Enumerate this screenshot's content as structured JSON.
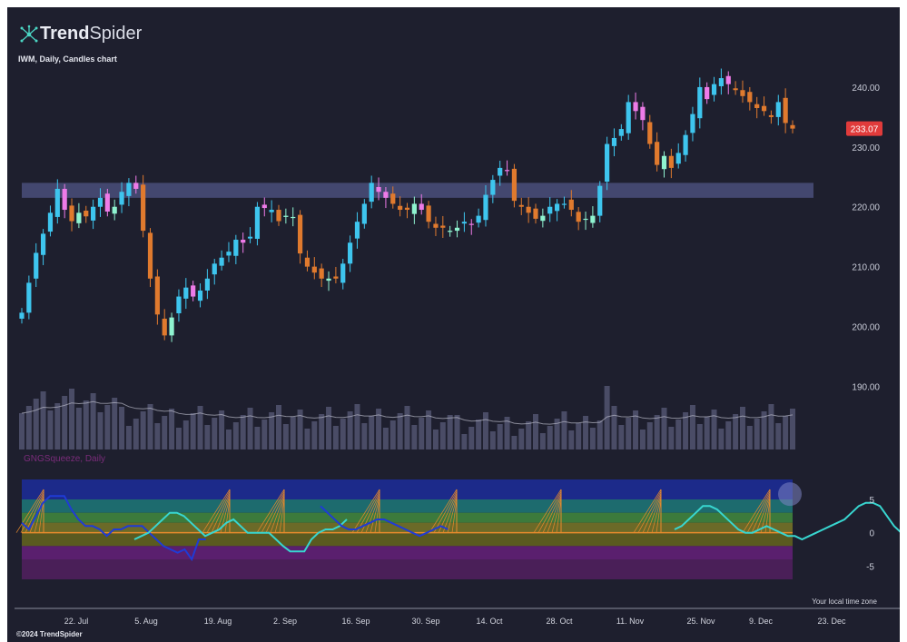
{
  "brand": {
    "name_bold": "Trend",
    "name_light": "Spider",
    "logo_icon": "spider-node-icon"
  },
  "chart_title": "IWM, Daily, Candles chart",
  "copyright": "©2024 TrendSpider",
  "timezone_label": "Your local time zone",
  "colors": {
    "background": "#1e1f2e",
    "bull": "#3ec5ee",
    "bull_weak": "#8ff3d0",
    "bear": "#e07a2e",
    "bear_weak": "#ee7be8",
    "price_badge": "#e13b3b",
    "zone": "#4a4f7a",
    "volume": "#4a4c66",
    "squeeze_line_blue": "#1f3bd6",
    "squeeze_line_cyan": "#38d6d0",
    "squeeze_signal": "#e88a2c"
  },
  "chart_data": [
    {
      "type": "candlestick",
      "symbol": "IWM",
      "timeframe": "Daily",
      "ylim": [
        180.5,
        245
      ],
      "y_ticks": [
        190,
        200,
        210,
        220,
        230,
        240
      ],
      "y_tick_labels": [
        "190.00",
        "200.00",
        "210.00",
        "220.00",
        "230.00",
        "240.00"
      ],
      "x_tick_labels": [
        "22. Jul",
        "5. Aug",
        "19. Aug",
        "2. Sep",
        "16. Sep",
        "30. Sep",
        "14. Oct",
        "28. Oct",
        "11. Nov",
        "25. Nov",
        "9. Dec",
        "23. Dec"
      ],
      "last_price": "233.07",
      "last_price_value": 233.07,
      "resistance_zone": [
        221.5,
        224
      ],
      "closes": [
        202.3,
        207.3,
        212.3,
        215.5,
        219.0,
        223.0,
        219.5,
        217.6,
        219.0,
        218.4,
        220.0,
        221.5,
        219.2,
        220.0,
        222.5,
        224.0,
        223.0,
        216.0,
        208.0,
        202.0,
        198.5,
        201.5,
        205.0,
        206.5,
        205.0,
        206.0,
        208.0,
        210.5,
        211.5,
        212.5,
        214.5,
        214.0,
        215.0,
        220.0,
        219.8,
        219.5,
        217.6,
        218.5,
        218.3,
        212.2,
        210.0,
        209.0,
        208.0,
        208.0,
        208.0,
        210.5,
        214.0,
        217.5,
        220.5,
        224.0,
        222.5,
        221.5,
        220.5,
        219.5,
        219.5,
        220.5,
        219.5,
        217.5,
        216.5,
        216.5,
        216.0,
        216.5,
        217.5,
        217.0,
        218.5,
        222.0,
        224.5,
        226.5,
        226.0,
        221.0,
        220.0,
        219.0,
        218.0,
        218.5,
        220.0,
        220.5,
        220.5,
        219.5,
        217.5,
        218.0,
        218.5,
        223.5,
        230.5,
        231.5,
        233.0,
        237.5,
        236.0,
        234.5,
        230.5,
        227.0,
        228.5,
        226.5,
        229.0,
        232.0,
        235.5,
        240.0,
        238.0,
        240.5,
        241.5,
        240.5,
        239.5,
        238.5,
        237.5,
        236.5,
        236.0,
        235.0,
        237.5,
        234.0,
        233.07
      ],
      "volume_note": "relative volume bars with moving average"
    },
    {
      "type": "line",
      "title": "GNGSqueeze, Daily",
      "ylim": [
        -7,
        8
      ],
      "y_ticks": [
        5,
        0,
        -5
      ],
      "y_tick_labels": [
        "5",
        "0",
        "-5"
      ],
      "series": [
        {
          "values": [
            1.5,
            0.5,
            2.5,
            4.5,
            5.5,
            5.5,
            5.5,
            3.5,
            2.0,
            1.0,
            1.0,
            0.5,
            -0.5,
            0.5,
            0.5,
            1.0,
            1.0,
            1.0,
            0.0,
            -1.0,
            -2.0,
            -2.5,
            -3.0,
            -2.5,
            -4.0,
            -1.0,
            -1.0
          ]
        },
        {
          "values": [
            -1.0,
            -0.5,
            0.0,
            1.0,
            2.0,
            3.0,
            3.0,
            2.5,
            1.5,
            0.5,
            -0.5,
            0.0,
            0.5,
            1.5,
            2.0,
            1.0,
            0.0,
            0.0,
            0.0,
            0.0,
            -1.0,
            -2.0,
            -2.8,
            -2.8,
            -2.8,
            -1.0,
            0.0,
            0.5,
            0.5,
            1.0,
            2.0
          ]
        },
        {
          "values": [
            4.0,
            3.0,
            2.0,
            1.0,
            0.5,
            0.5,
            1.0,
            1.5,
            2.0,
            2.0,
            1.5,
            1.0,
            0.5,
            0.0,
            -0.5,
            0.0,
            0.5,
            1.0,
            0.5
          ]
        },
        {
          "values": [
            0.5,
            1.0,
            2.0,
            3.0,
            4.0,
            4.0,
            3.5,
            2.5,
            1.5,
            0.5,
            0.0,
            0.0,
            0.5,
            1.0,
            0.5,
            0.0,
            -0.5,
            -0.5,
            -1.0,
            -0.5,
            0.0,
            0.5,
            1.0,
            1.5,
            2.0,
            3.0,
            4.0,
            4.5,
            4.5,
            4.0,
            2.5,
            1.0,
            0.0,
            -0.5,
            0.0,
            0.5,
            1.0,
            0.5,
            0.0,
            -0.5,
            0.5,
            0.0
          ]
        }
      ]
    }
  ]
}
